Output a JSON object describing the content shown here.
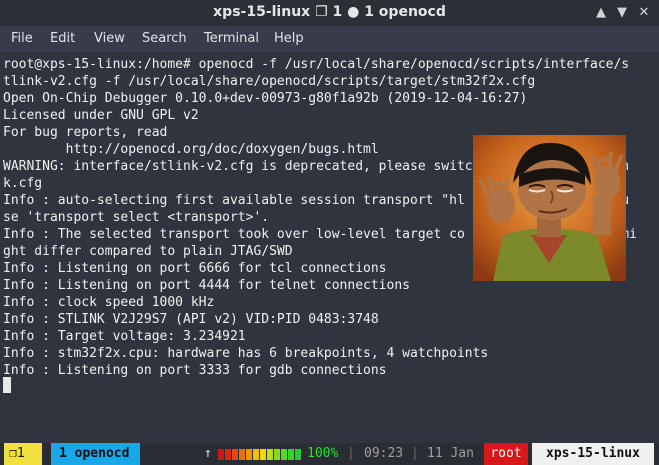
{
  "window": {
    "title": "xps-15-linux ❐ 1 ● 1 openocd",
    "controls": {
      "minimize": "▲",
      "maximize": "▼",
      "close": "✕"
    }
  },
  "menubar": {
    "items": [
      "File",
      "Edit",
      "View",
      "Search",
      "Terminal",
      "Help"
    ]
  },
  "terminal": {
    "lines": [
      "root@xps-15-linux:/home# openocd -f /usr/local/share/openocd/scripts/interface/s",
      "tlink-v2.cfg -f /usr/local/share/openocd/scripts/target/stm32f2x.cfg",
      "Open On-Chip Debugger 0.10.0+dev-00973-g80f1a92b (2019-12-04-16:27)",
      "Licensed under GNU GPL v2",
      "For bug reports, read",
      "        http://openocd.org/doc/doxygen/bugs.html",
      "WARNING: interface/stlink-v2.cfg is deprecated, please switch to interface/stlin",
      "k.cfg",
      "Info : auto-selecting first available session transport \"hl                    u",
      "se 'transport select <transport>'.",
      "Info : The selected transport took over low-level target co                    mi",
      "ght differ compared to plain JTAG/SWD",
      "Info : Listening on port 6666 for tcl connections",
      "Info : Listening on port 4444 for telnet connections",
      "Info : clock speed 1000 kHz",
      "Info : STLINK V2J29S7 (API v2) VID:PID 0483:3748",
      "Info : Target voltage: 3.234921",
      "Info : stm32f2x.cpu: hardware has 6 breakpoints, 4 watchpoints",
      "Info : Listening on port 3333 for gdb connections"
    ]
  },
  "statusbar": {
    "session": "❐1",
    "window_tab": "1 openocd",
    "upload_arrow": "↑",
    "battery_percent": "100%",
    "battery_level": 1.0,
    "time": "09:23",
    "date": "11 Jan",
    "user": "root",
    "host": "xps-15-linux"
  }
}
